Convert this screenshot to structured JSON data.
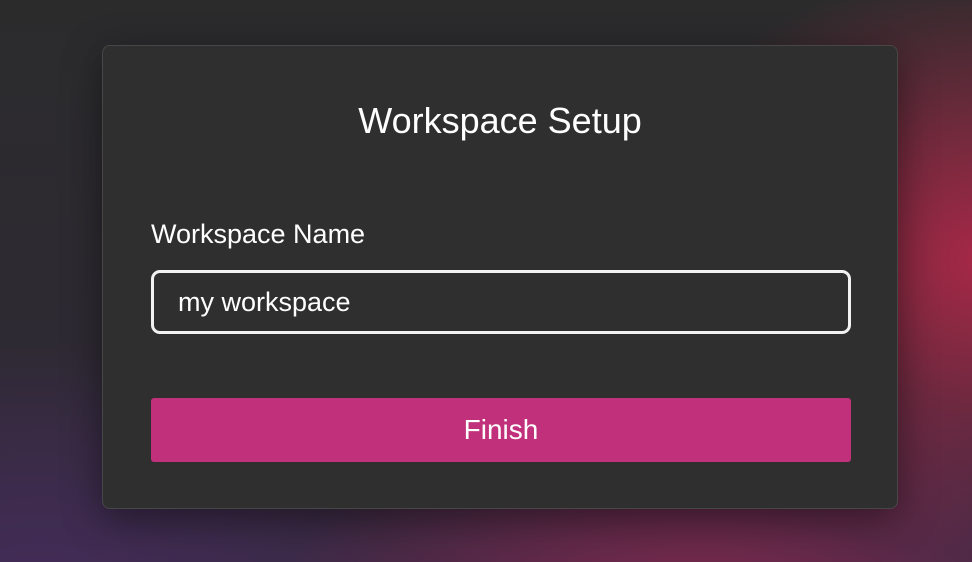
{
  "dialog": {
    "title": "Workspace Setup",
    "name_field": {
      "label": "Workspace Name",
      "value": "my workspace",
      "placeholder": ""
    },
    "finish_label": "Finish"
  },
  "colors": {
    "dialog_background": "#2f2f2f",
    "accent": "#c1307a",
    "text": "#ffffff",
    "input_border": "#f2f2f2"
  }
}
